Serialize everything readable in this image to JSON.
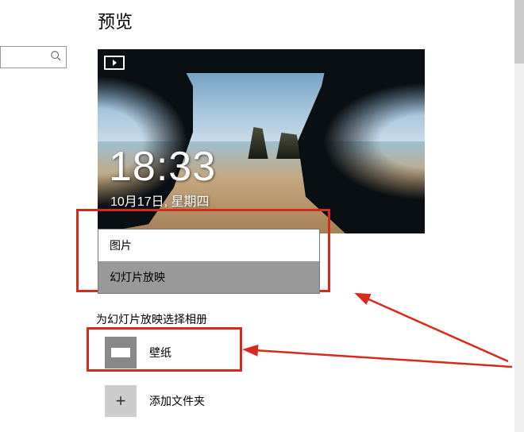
{
  "header": {
    "title": "预览"
  },
  "lockscreen": {
    "time": "18:33",
    "date": "10月17日, 星期四"
  },
  "background_dropdown": {
    "options": [
      {
        "label": "图片",
        "selected": false
      },
      {
        "label": "幻灯片放映",
        "selected": true
      }
    ]
  },
  "albums": {
    "section_label": "为幻灯片放映选择相册",
    "items": [
      {
        "label": "壁纸"
      }
    ],
    "add_label": "添加文件夹"
  },
  "annotation": {
    "arrow_color": "#d82a1a"
  }
}
